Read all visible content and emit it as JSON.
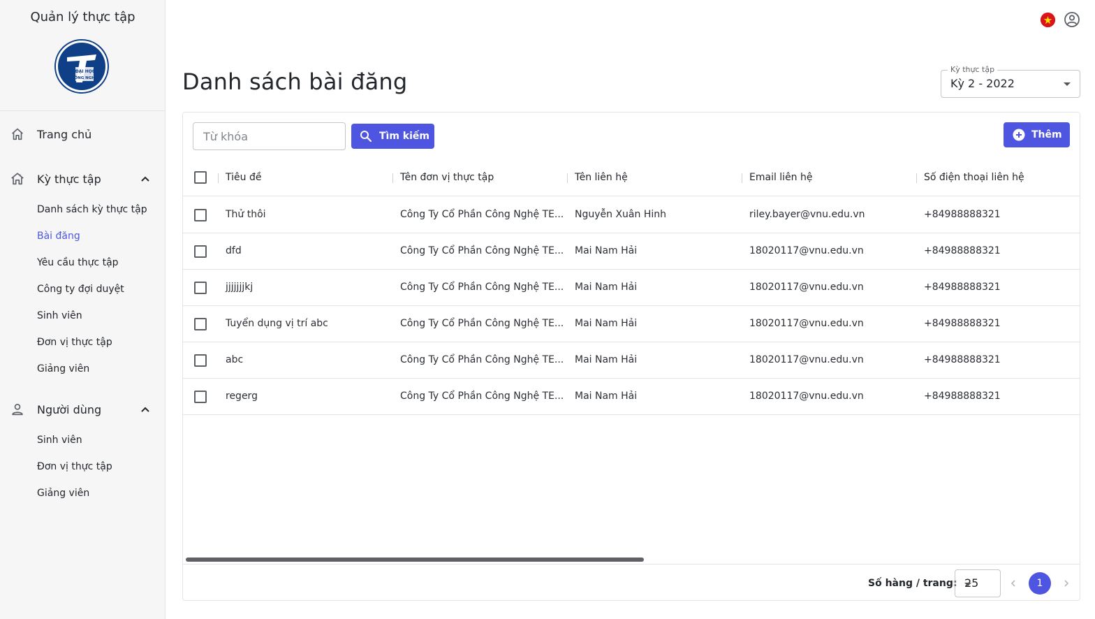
{
  "app": {
    "title": "Quản lý thực tập",
    "logo_text": [
      "ĐẠI HỌC",
      "CÔNG NGHỆ"
    ]
  },
  "sidebar": {
    "home": {
      "label": "Trang chủ",
      "icon": "home-icon"
    },
    "internship_group": {
      "label": "Kỳ thực tập",
      "icon": "home-outline-icon",
      "expanded": true,
      "items": [
        {
          "label": "Danh sách kỳ thực tập"
        },
        {
          "label": "Bài đăng",
          "active": true
        },
        {
          "label": "Yêu cầu thực tập"
        },
        {
          "label": "Công ty đợi duyệt"
        },
        {
          "label": "Sinh viên"
        },
        {
          "label": "Đơn vị thực tập"
        },
        {
          "label": "Giảng viên"
        }
      ]
    },
    "users_group": {
      "label": "Người dùng",
      "icon": "person-icon",
      "expanded": true,
      "items": [
        {
          "label": "Sinh viên"
        },
        {
          "label": "Đơn vị thực tập"
        },
        {
          "label": "Giảng viên"
        }
      ]
    }
  },
  "topbar": {
    "language_icon": "vietnam-flag-icon",
    "account_icon": "account-circle-icon"
  },
  "page": {
    "title": "Danh sách bài đăng"
  },
  "term_select": {
    "label": "Kỳ thực tập",
    "value": "Kỳ 2 - 2022"
  },
  "toolbar": {
    "search_placeholder": "Từ khóa",
    "search_label": "Tìm kiếm",
    "add_label": "Thêm"
  },
  "table": {
    "columns": [
      "Tiêu đề",
      "Tên đơn vị thực tập",
      "Tên liên hệ",
      "Email liên hệ",
      "Số điện thoại liên hệ"
    ],
    "rows": [
      [
        "Thử thôi",
        "Công Ty Cổ Phần Công Nghệ TE...",
        "Nguyễn Xuân Hinh",
        "riley.bayer@vnu.edu.vn",
        "+84988888321"
      ],
      [
        "dfd",
        "Công Ty Cổ Phần Công Nghệ TE...",
        "Mai Nam Hải",
        "18020117@vnu.edu.vn",
        "+84988888321"
      ],
      [
        "jjjjjjjkj",
        "Công Ty Cổ Phần Công Nghệ TE...",
        "Mai Nam Hải",
        "18020117@vnu.edu.vn",
        "+84988888321"
      ],
      [
        "Tuyển dụng vị trí abc",
        "Công Ty Cổ Phần Công Nghệ TE...",
        "Mai Nam Hải",
        "18020117@vnu.edu.vn",
        "+84988888321"
      ],
      [
        "abc",
        "Công Ty Cổ Phần Công Nghệ TE...",
        "Mai Nam Hải",
        "18020117@vnu.edu.vn",
        "+84988888321"
      ],
      [
        "regerg",
        "Công Ty Cổ Phần Công Nghệ TE...",
        "Mai Nam Hải",
        "18020117@vnu.edu.vn",
        "+84988888321"
      ]
    ]
  },
  "pagination": {
    "rows_per_page_label": "Số hàng / trang:",
    "rows_per_page": "25",
    "current_page": "1"
  },
  "colors": {
    "primary": "#4e55e0",
    "sidebar_bg": "#f6f6f7",
    "flag_red": "#d9141b"
  }
}
